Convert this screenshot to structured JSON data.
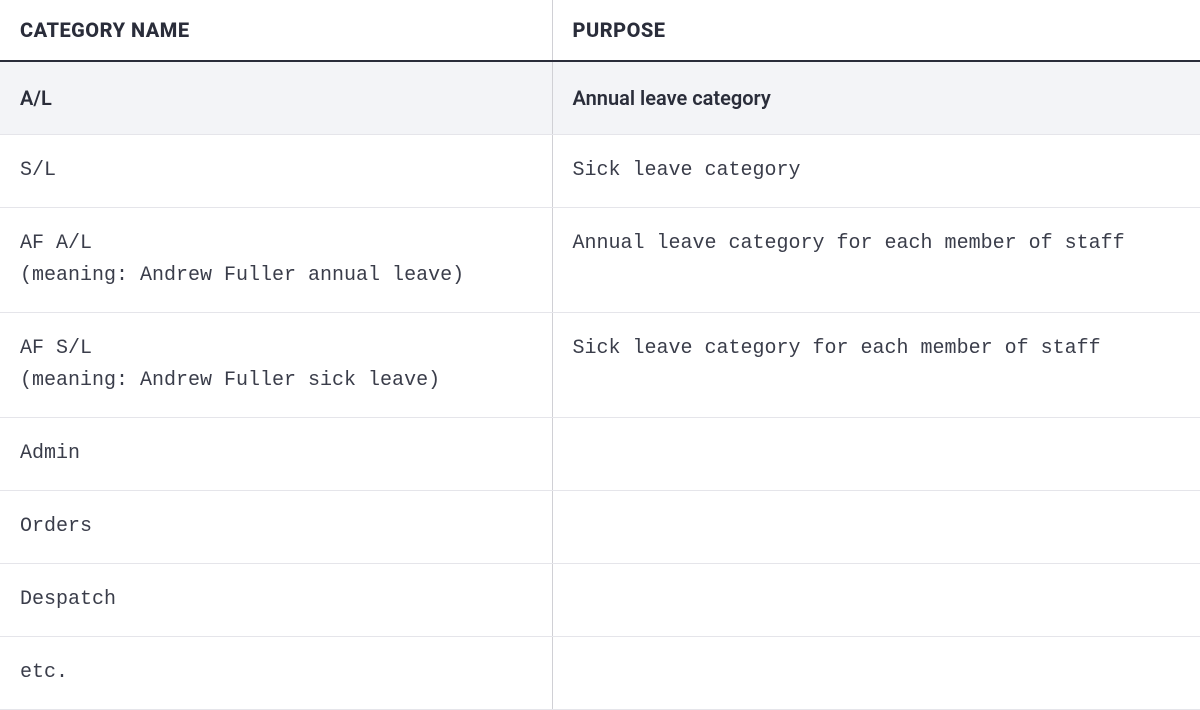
{
  "table": {
    "headers": {
      "col1": "Category Name",
      "col2": "Purpose"
    },
    "rows": [
      {
        "highlight": true,
        "name": "A/L",
        "sub": "",
        "purpose": "Annual leave category"
      },
      {
        "highlight": false,
        "name": "S/L",
        "sub": "",
        "purpose": "Sick leave category"
      },
      {
        "highlight": false,
        "name": "AF A/L",
        "sub": "(meaning: Andrew Fuller annual leave)",
        "purpose": "Annual leave category for each member of staff"
      },
      {
        "highlight": false,
        "name": "AF S/L",
        "sub": "(meaning: Andrew Fuller sick leave)",
        "purpose": "Sick leave category for each member of staff"
      },
      {
        "highlight": false,
        "name": "Admin",
        "sub": "",
        "purpose": ""
      },
      {
        "highlight": false,
        "name": "Orders",
        "sub": "",
        "purpose": ""
      },
      {
        "highlight": false,
        "name": "Despatch",
        "sub": "",
        "purpose": ""
      },
      {
        "highlight": false,
        "name": "etc.",
        "sub": "",
        "purpose": ""
      }
    ]
  }
}
